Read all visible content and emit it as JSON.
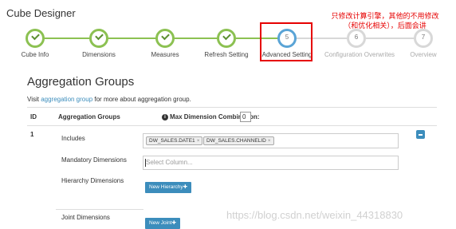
{
  "app": {
    "title": "Cube Designer"
  },
  "wizard": {
    "steps": [
      {
        "label": "Cube Info",
        "state": "done",
        "number": ""
      },
      {
        "label": "Dimensions",
        "state": "done",
        "number": ""
      },
      {
        "label": "Measures",
        "state": "done",
        "number": ""
      },
      {
        "label": "Refresh Setting",
        "state": "done",
        "number": ""
      },
      {
        "label": "Advanced Setting",
        "state": "active",
        "number": "5"
      },
      {
        "label": "Configuration Overwrites",
        "state": "todo",
        "number": "6"
      },
      {
        "label": "Overview",
        "state": "todo",
        "number": "7"
      }
    ],
    "colors": {
      "done": "#8cc152",
      "active": "#5aa4d6",
      "todo": "#d8d8d8"
    }
  },
  "annotation": {
    "line1": "只修改计算引擎，其他的不用修改",
    "line2": "（和优化相关），后面会讲",
    "color": "#e60000"
  },
  "section": {
    "title": "Aggregation Groups",
    "visit_prefix": "Visit ",
    "visit_link": "aggregation group",
    "visit_suffix": " for more about aggregation group."
  },
  "table": {
    "headers": {
      "id": "ID",
      "groups": "Aggregation Groups",
      "max_dim": "Max Dimension Combination:"
    },
    "max_dim_value": "0",
    "row": {
      "id": "1",
      "includes_label": "Includes",
      "includes_tags": [
        "DW_SALES.DATE1",
        "DW_SALES.CHANNELID"
      ],
      "mandatory_label": "Mandatory Dimensions",
      "mandatory_placeholder": "Select Column...",
      "hierarchy_label": "Hierarchy Dimensions",
      "new_hierarchy": "New Hierarchy✚",
      "joint_label": "Joint Dimensions",
      "new_joint": "New Joint✚"
    }
  },
  "watermark": "https://blog.csdn.net/weixin_44318830"
}
